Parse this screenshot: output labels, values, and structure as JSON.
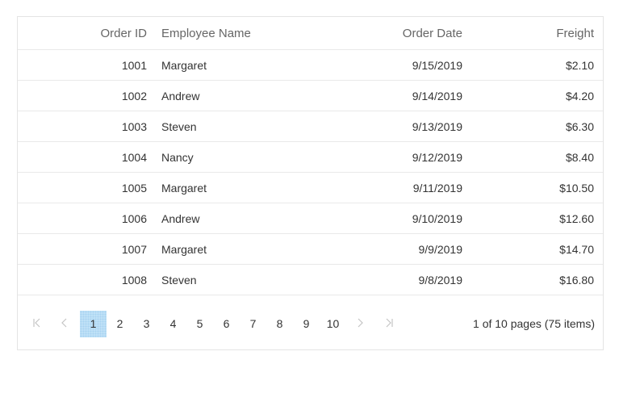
{
  "grid": {
    "columns": [
      "Order ID",
      "Employee Name",
      "Order Date",
      "Freight"
    ],
    "rows": [
      [
        "1001",
        "Margaret",
        "9/15/2019",
        "$2.10"
      ],
      [
        "1002",
        "Andrew",
        "9/14/2019",
        "$4.20"
      ],
      [
        "1003",
        "Steven",
        "9/13/2019",
        "$6.30"
      ],
      [
        "1004",
        "Nancy",
        "9/12/2019",
        "$8.40"
      ],
      [
        "1005",
        "Margaret",
        "9/11/2019",
        "$10.50"
      ],
      [
        "1006",
        "Andrew",
        "9/10/2019",
        "$12.60"
      ],
      [
        "1007",
        "Margaret",
        "9/9/2019",
        "$14.70"
      ],
      [
        "1008",
        "Steven",
        "9/8/2019",
        "$16.80"
      ]
    ]
  },
  "pager": {
    "pages": [
      "1",
      "2",
      "3",
      "4",
      "5",
      "6",
      "7",
      "8",
      "9",
      "10"
    ],
    "current_page": "1",
    "info": "1 of 10 pages (75 items)",
    "icons": {
      "first": "first-page-icon",
      "prev": "previous-page-icon",
      "next": "next-page-icon",
      "last": "last-page-icon"
    },
    "colors": {
      "active_bg": "#bfe1f7",
      "disabled_icon": "#c4c4c4"
    }
  }
}
